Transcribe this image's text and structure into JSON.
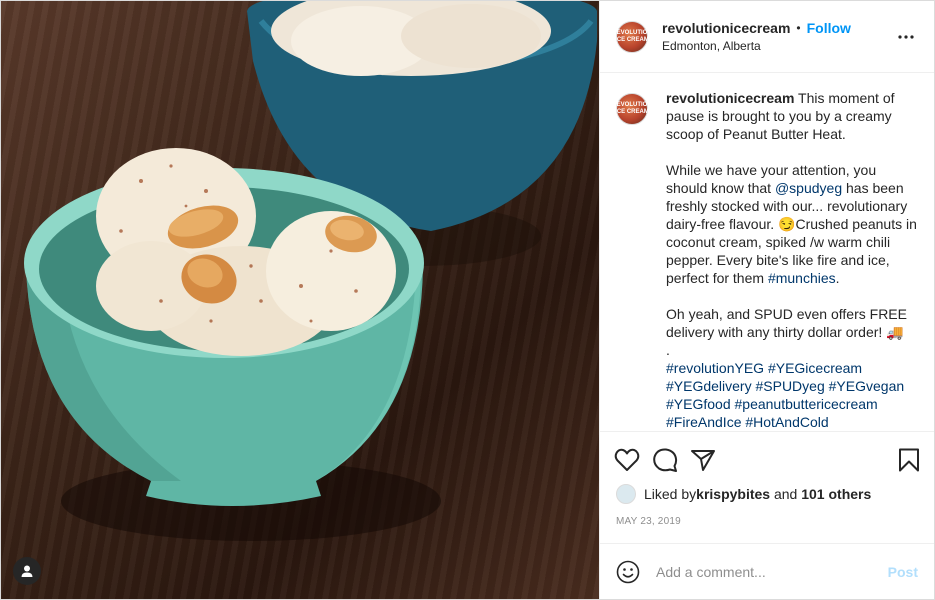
{
  "header": {
    "username": "revolutionicecream",
    "separator": "•",
    "follow_label": "Follow",
    "location": "Edmonton, Alberta",
    "avatar_text": "REVOLUTION ICE CREAM"
  },
  "caption": {
    "username": "revolutionicecream",
    "p1": " This moment of pause is brought to you by a creamy scoop of Peanut Butter Heat.",
    "p2a": "While we have your attention, you should know that ",
    "mention": "@spudyeg",
    "p2b": " has been freshly stocked with our... revolutionary dairy-free flavour. 😏Crushed peanuts in coconut cream, spiked /w warm chili pepper. Every bite's like fire and ice, perfect for them ",
    "hashtag_munchies": "#munchies",
    "p2c": ".",
    "p3": "Oh yeah, and SPUD even offers FREE delivery with any thirty dollar order! 🚚",
    "p3dot": ".",
    "hashtags": [
      "#revolutionYEG",
      "#YEGicecream",
      "#YEGdelivery",
      "#SPUDyeg",
      "#YEGvegan",
      "#YEGfood",
      "#peanutbuttericecream",
      "#FireAndIce",
      "#HotAndCold"
    ]
  },
  "icons": {
    "like": "heart-icon",
    "comment": "comment-icon",
    "share": "paper-plane-icon",
    "save": "bookmark-icon",
    "more": "more-dots-icon",
    "tag": "user-tag-icon",
    "emoji": "smiley-icon"
  },
  "likes": {
    "prefix": "Liked by ",
    "user": "krispybites",
    "middle": " and ",
    "others": "101 others"
  },
  "date": "MAY 23, 2019",
  "comment_box": {
    "placeholder": "Add a comment...",
    "post_label": "Post"
  },
  "colors": {
    "accent": "#0095f6",
    "link": "#00376b",
    "post_disabled": "#b2dffc",
    "bowl_teal": "#6fc5b3",
    "bowl_blue": "#1f5f78"
  }
}
